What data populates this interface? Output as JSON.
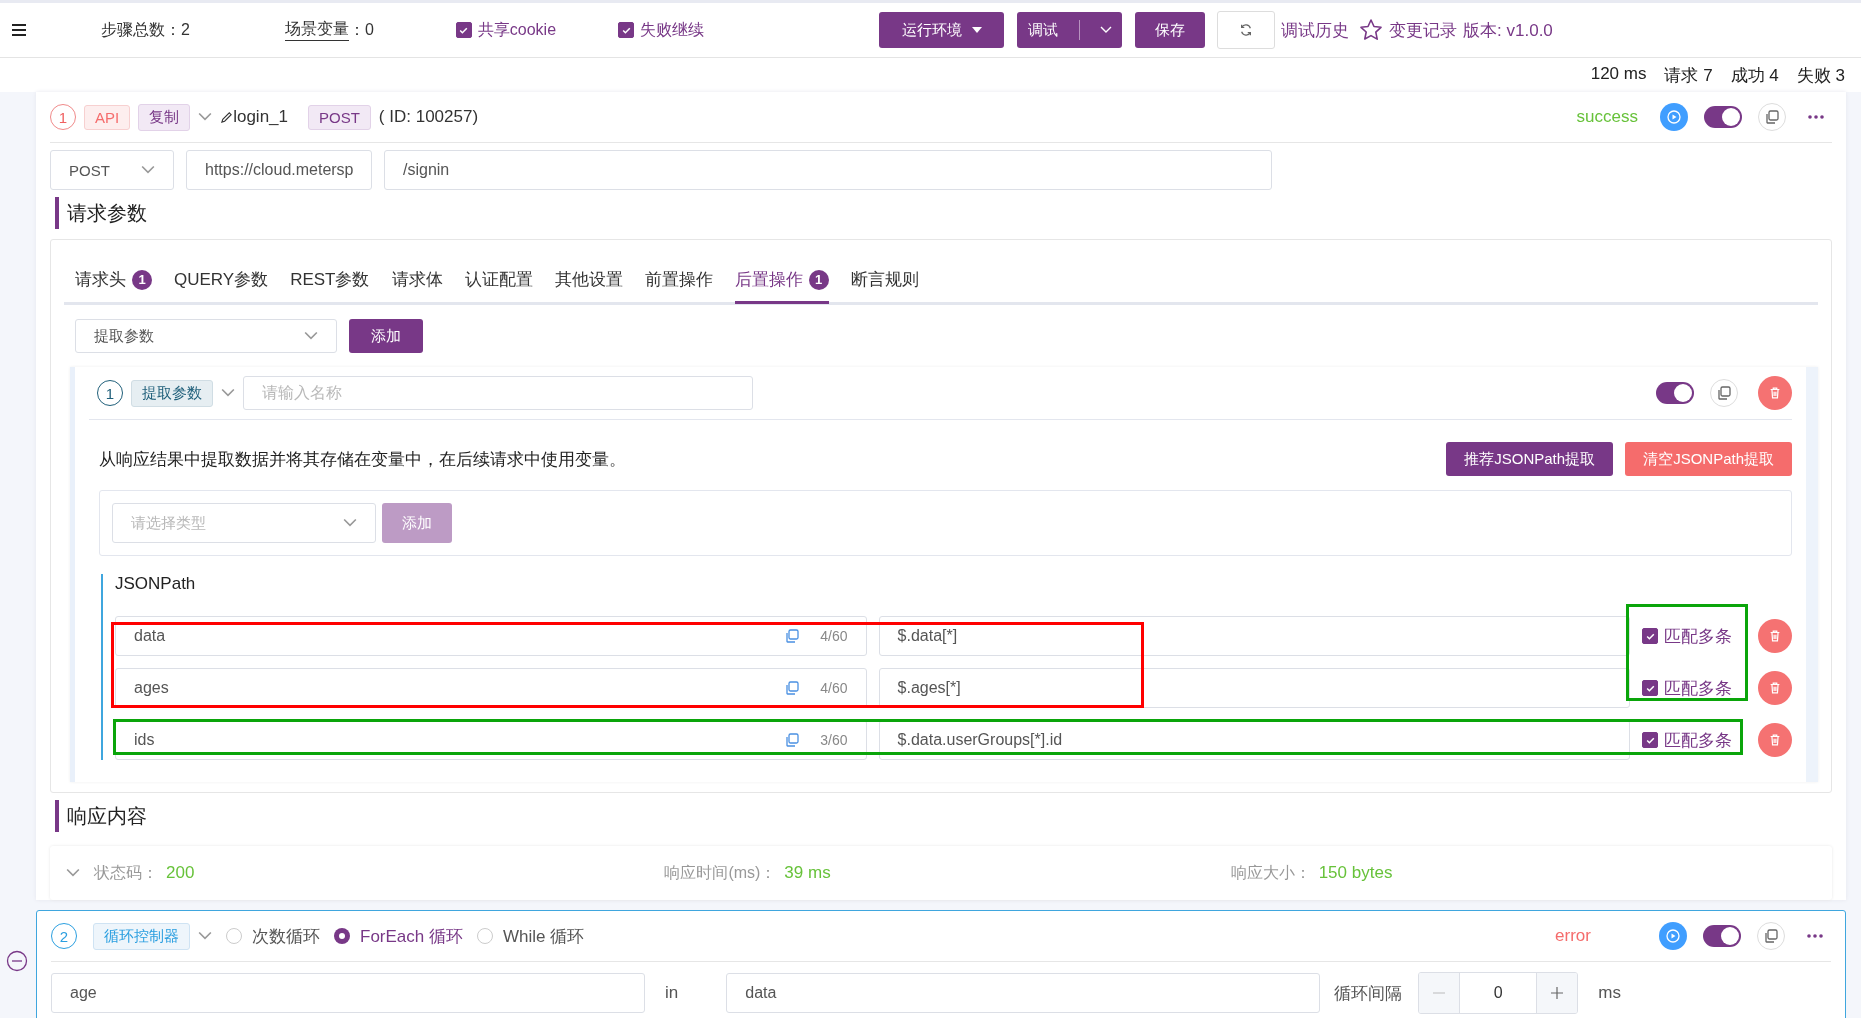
{
  "toolbar": {
    "step_count": "步骤总数：2",
    "scene_vars_label": "场景变量",
    "scene_vars_value": "：0",
    "checkboxes": [
      {
        "label": "共享cookie",
        "checked": true
      },
      {
        "label": "失败继续",
        "checked": true
      }
    ],
    "env_button": "运行环境",
    "debug_button": "调试",
    "save_button": "保存",
    "history_link": "调试历史",
    "changes_link": "变更记录",
    "version": "版本: v1.0.0"
  },
  "summary": [
    "120 ms",
    "请求 7",
    "成功 4",
    "失败 3"
  ],
  "api_step": {
    "index": "1",
    "type_tag": "API",
    "copy_tag": "复制",
    "name": "login_1",
    "method_tag": "POST",
    "id": "( ID: 100257)",
    "status": "success",
    "color": "#67c23a",
    "enabled": true,
    "method": "POST",
    "base_url": "https://cloud.metersp",
    "path": "/signin",
    "request_section": "请求参数",
    "tabs": [
      {
        "label": "请求头",
        "badge": "1",
        "selected": false
      },
      {
        "label": "QUERY参数",
        "selected": false
      },
      {
        "label": "REST参数",
        "selected": false
      },
      {
        "label": "请求体",
        "selected": false
      },
      {
        "label": "认证配置",
        "selected": false
      },
      {
        "label": "其他设置",
        "selected": false
      },
      {
        "label": "前置操作",
        "selected": false
      },
      {
        "label": "后置操作",
        "badge": "1",
        "selected": true
      },
      {
        "label": "断言规则",
        "selected": false
      }
    ],
    "processor_select": "提取参数",
    "add_button": "添加",
    "processor": {
      "index": "1",
      "tag": "提取参数",
      "name_placeholder": "请输入名称",
      "enabled": true,
      "description": "从响应结果中提取数据并将其存储在变量中，在后续请求中使用变量。",
      "recommend_button": "推荐JSONPath提取",
      "clear_button": "清空JSONPath提取",
      "type_placeholder": "请选择类型",
      "type_add_button": "添加",
      "group_label": "JSONPath",
      "rows": [
        {
          "name": "data",
          "count": "4/60",
          "expression": "$.data[*]",
          "match_label": "匹配多条",
          "multiple": true
        },
        {
          "name": "ages",
          "count": "4/60",
          "expression": "$.ages[*]",
          "match_label": "匹配多条",
          "multiple": true
        },
        {
          "name": "ids",
          "count": "3/60",
          "expression": "$.data.userGroups[*].id",
          "match_label": "匹配多条",
          "multiple": true
        }
      ],
      "annotations": [
        {
          "color": "#ff0000"
        },
        {
          "color": "#0aa50a"
        },
        {
          "color": "#0aa50a"
        }
      ]
    },
    "response_section": "响应内容",
    "response": {
      "status_label": "状态码：",
      "status": "200",
      "time_label": "响应时间(ms)：",
      "time": "39 ms",
      "size_label": "响应大小：",
      "size": "150 bytes"
    }
  },
  "loop_step": {
    "index": "2",
    "tag": "循环控制器",
    "modes": [
      {
        "label": "次数循环",
        "selected": false
      },
      {
        "label": "ForEach 循环",
        "selected": true
      },
      {
        "label": "While 循环",
        "selected": false
      }
    ],
    "status": "error",
    "color": "#f56c6c",
    "enabled": true,
    "variable": "age",
    "in_label": "in",
    "collection": "data",
    "interval_label": "循环间隔",
    "interval": "0",
    "unit": "ms"
  }
}
